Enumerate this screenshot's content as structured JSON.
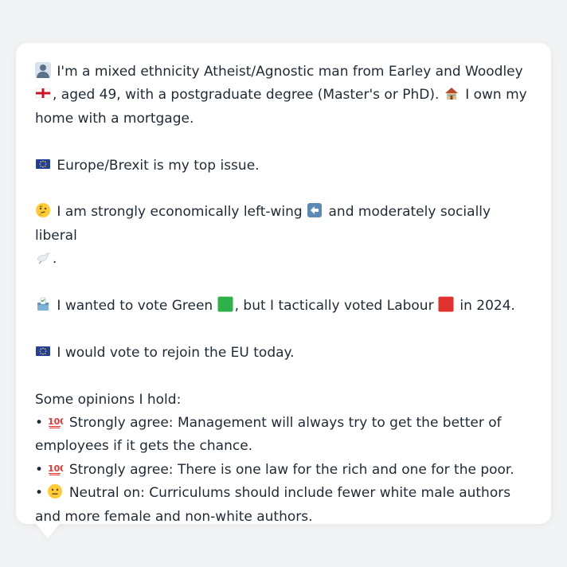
{
  "profile": {
    "identity_text": "I'm a mixed ethnicity Atheist/Agnostic man from Earley and Woodley",
    "identity_text_2": ", aged 49, with a postgraduate degree (Master's or PhD).",
    "home_text": "I own my home with a mortgage.",
    "issue_text": "Europe/Brexit is my top issue.",
    "econ_text_1": "I am strongly economically left-wing",
    "econ_text_2": "and moderately socially liberal",
    "econ_text_3": ".",
    "vote_text_1": "I wanted to vote Green",
    "vote_text_2": ", but I tactically voted Labour",
    "vote_text_3": "in 2024.",
    "eu_text": "I would vote to rejoin the EU today.",
    "opinions_heading": "Some opinions I hold:",
    "opinions": [
      {
        "bullet": "•",
        "label": "Strongly agree: Management will always try to get the better of employees if it gets the chance."
      },
      {
        "bullet": "•",
        "label": "Strongly agree: There is one law for the rich and one for the poor."
      },
      {
        "bullet": "•",
        "label": "Neutral on: Curriculums should include fewer white male authors and more female and non-white authors."
      }
    ]
  },
  "colors": {
    "background": "#f2f3f5",
    "bubble": "#ffffff",
    "text": "#1f2a36",
    "green_square": "#2fb14a",
    "red_square": "#e0312f",
    "eu_blue": "#243f99"
  }
}
